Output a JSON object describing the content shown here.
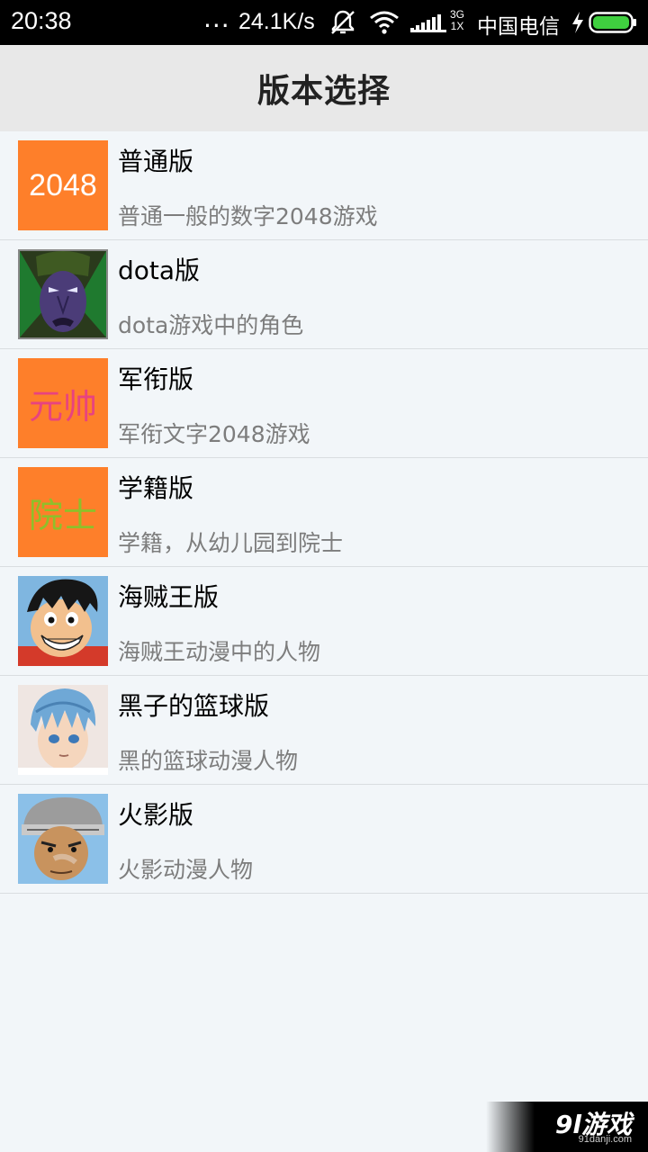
{
  "status_bar": {
    "time": "20:38",
    "dots": "...",
    "speed": "24.1K/s",
    "net_type_top": "3G",
    "net_type_bottom": "1X",
    "carrier": "中国电信",
    "icons": [
      "mute-icon",
      "wifi-icon",
      "signal-icon",
      "charging-icon",
      "battery-icon"
    ],
    "battery_color": "#3fcf3f"
  },
  "header": {
    "title": "版本选择"
  },
  "versions": [
    {
      "title": "普通版",
      "desc": "普通一般的数字2048游戏",
      "thumb": {
        "kind": "text",
        "text": "2048",
        "color": "#ffffff"
      }
    },
    {
      "title": "dota版",
      "desc": "dota游戏中的角色",
      "thumb": {
        "kind": "image",
        "icon": "dota-hero-portrait"
      }
    },
    {
      "title": "军衔版",
      "desc": "军衔文字2048游戏",
      "thumb": {
        "kind": "text",
        "text": "元帅",
        "color": "#e8437f"
      }
    },
    {
      "title": "学籍版",
      "desc": "学籍，从幼儿园到院士",
      "thumb": {
        "kind": "text",
        "text": "院士",
        "color": "#8fbf2a"
      }
    },
    {
      "title": "海贼王版",
      "desc": "海贼王动漫中的人物",
      "thumb": {
        "kind": "image",
        "icon": "luffy-portrait"
      }
    },
    {
      "title": "黑子的篮球版",
      "desc": "黑的篮球动漫人物",
      "thumb": {
        "kind": "image",
        "icon": "kuroko-portrait"
      }
    },
    {
      "title": "火影版",
      "desc": "火影动漫人物",
      "thumb": {
        "kind": "image",
        "icon": "naruto-character-portrait"
      }
    }
  ],
  "watermark": {
    "main": "9l游戏",
    "sub": "91danji.com"
  },
  "colors": {
    "thumb_bg": "#fe7f2a",
    "list_bg": "#f2f6f9",
    "header_bg": "#e8e8e8"
  }
}
